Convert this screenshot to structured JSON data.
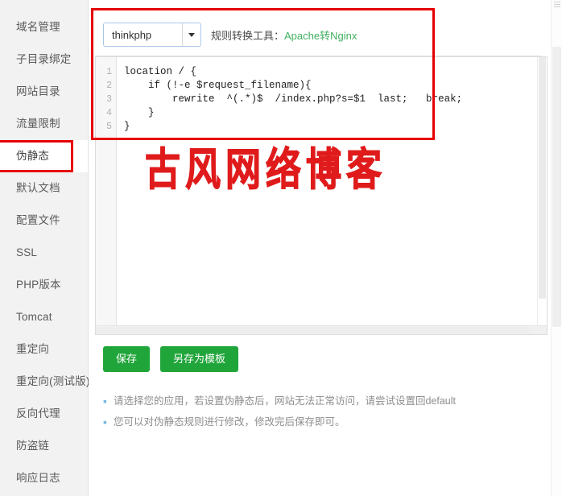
{
  "sidebar": {
    "items": [
      {
        "label": "域名管理",
        "active": false
      },
      {
        "label": "子目录绑定",
        "active": false
      },
      {
        "label": "网站目录",
        "active": false
      },
      {
        "label": "流量限制",
        "active": false
      },
      {
        "label": "伪静态",
        "active": true
      },
      {
        "label": "默认文档",
        "active": false
      },
      {
        "label": "配置文件",
        "active": false
      },
      {
        "label": "SSL",
        "active": false
      },
      {
        "label": "PHP版本",
        "active": false
      },
      {
        "label": "Tomcat",
        "active": false
      },
      {
        "label": "重定向",
        "active": false
      },
      {
        "label": "重定向(测试版)",
        "active": false
      },
      {
        "label": "反向代理",
        "active": false
      },
      {
        "label": "防盗链",
        "active": false
      },
      {
        "label": "响应日志",
        "active": false
      }
    ]
  },
  "toolbar": {
    "select": {
      "value": "thinkphp",
      "options": [
        "thinkphp"
      ]
    },
    "converter_label": "规则转换工具：",
    "converter_link": "Apache转Nginx"
  },
  "editor": {
    "line_numbers": [
      "1",
      "2",
      "3",
      "4",
      "5"
    ],
    "code": "location / {\n    if (!-e $request_filename){\n        rewrite  ^(.*)$  /index.php?s=$1  last;   break;\n    }\n}"
  },
  "watermark": {
    "text": "古风网络博客"
  },
  "buttons": {
    "save": "保存",
    "save_as_template": "另存为模板"
  },
  "notes": [
    "请选择您的应用，若设置伪静态后，网站无法正常访问，请尝试设置回default",
    "您可以对伪静态规则进行修改，修改完后保存即可。"
  ],
  "colors": {
    "accent_green": "#20a53a",
    "link_green": "#40b060",
    "annotation_red": "#e60000",
    "watermark_red": "#e01b1b",
    "sidebar_bg": "#f2f2f2"
  }
}
